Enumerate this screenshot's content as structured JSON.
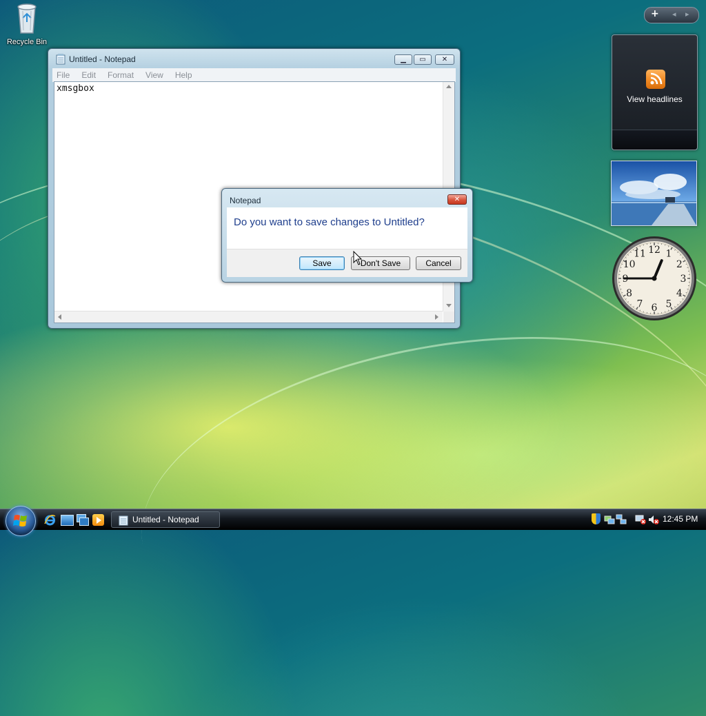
{
  "desktop": {
    "recycle_bin_label": "Recycle Bin"
  },
  "notepad": {
    "title": "Untitled - Notepad",
    "menu": [
      "File",
      "Edit",
      "Format",
      "View",
      "Help"
    ],
    "content": "xmsgbox",
    "minimize_glyph": "▁",
    "maximize_glyph": "▭",
    "close_glyph": "✕"
  },
  "dialog": {
    "title": "Notepad",
    "message": "Do you want to save changes to Untitled?",
    "buttons": {
      "save": "Save",
      "dont_save": "Don't Save",
      "cancel": "Cancel"
    },
    "close_glyph": "✕"
  },
  "sidebar": {
    "add_glyph": "+",
    "prev_glyph": "◂",
    "next_glyph": "▸",
    "feed_gadget_label": "View headlines",
    "clock_numbers": [
      "12",
      "1",
      "2",
      "3",
      "4",
      "5",
      "6",
      "7",
      "8",
      "9",
      "10",
      "11"
    ],
    "clock_time": {
      "hour": 12,
      "minute": 45
    }
  },
  "taskbar": {
    "task_label": "Untitled - Notepad",
    "clock": "12:45 PM"
  },
  "colors": {
    "rss_orange": "#f08a24",
    "dialog_text_blue": "#1e3e8c"
  }
}
